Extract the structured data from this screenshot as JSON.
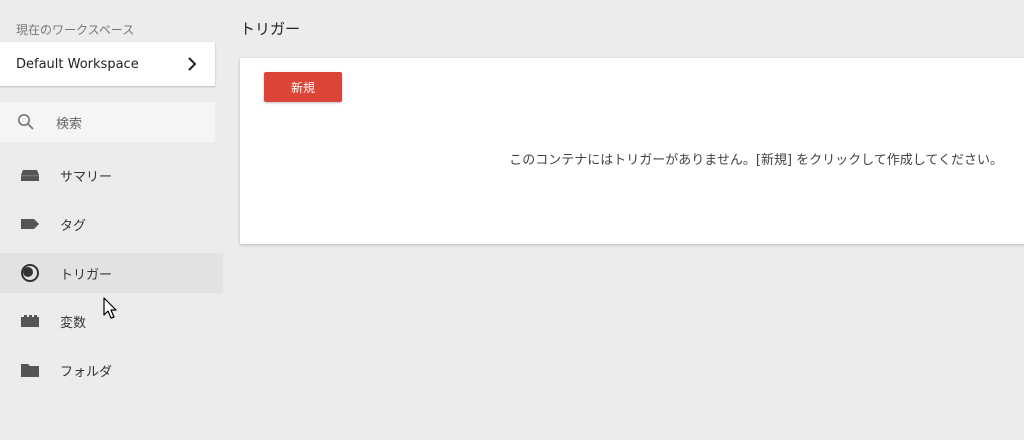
{
  "sidebar": {
    "workspace_caption": "現在のワークスペース",
    "workspace_name": "Default Workspace",
    "search_placeholder": "検索",
    "items": [
      {
        "label": "サマリー",
        "icon": "summary-icon"
      },
      {
        "label": "タグ",
        "icon": "tag-icon"
      },
      {
        "label": "トリガー",
        "icon": "trigger-icon"
      },
      {
        "label": "変数",
        "icon": "variable-icon"
      },
      {
        "label": "フォルダ",
        "icon": "folder-icon"
      }
    ],
    "active_item": "トリガー"
  },
  "main": {
    "title": "トリガー",
    "new_button_label": "新規",
    "empty_message": "このコンテナにはトリガーがありません。[新規] をクリックして作成してください。"
  },
  "colors": {
    "background": "#ececec",
    "accent_red": "#db4437",
    "icon_gray": "#555555",
    "active_row": "#e2e2e2"
  }
}
